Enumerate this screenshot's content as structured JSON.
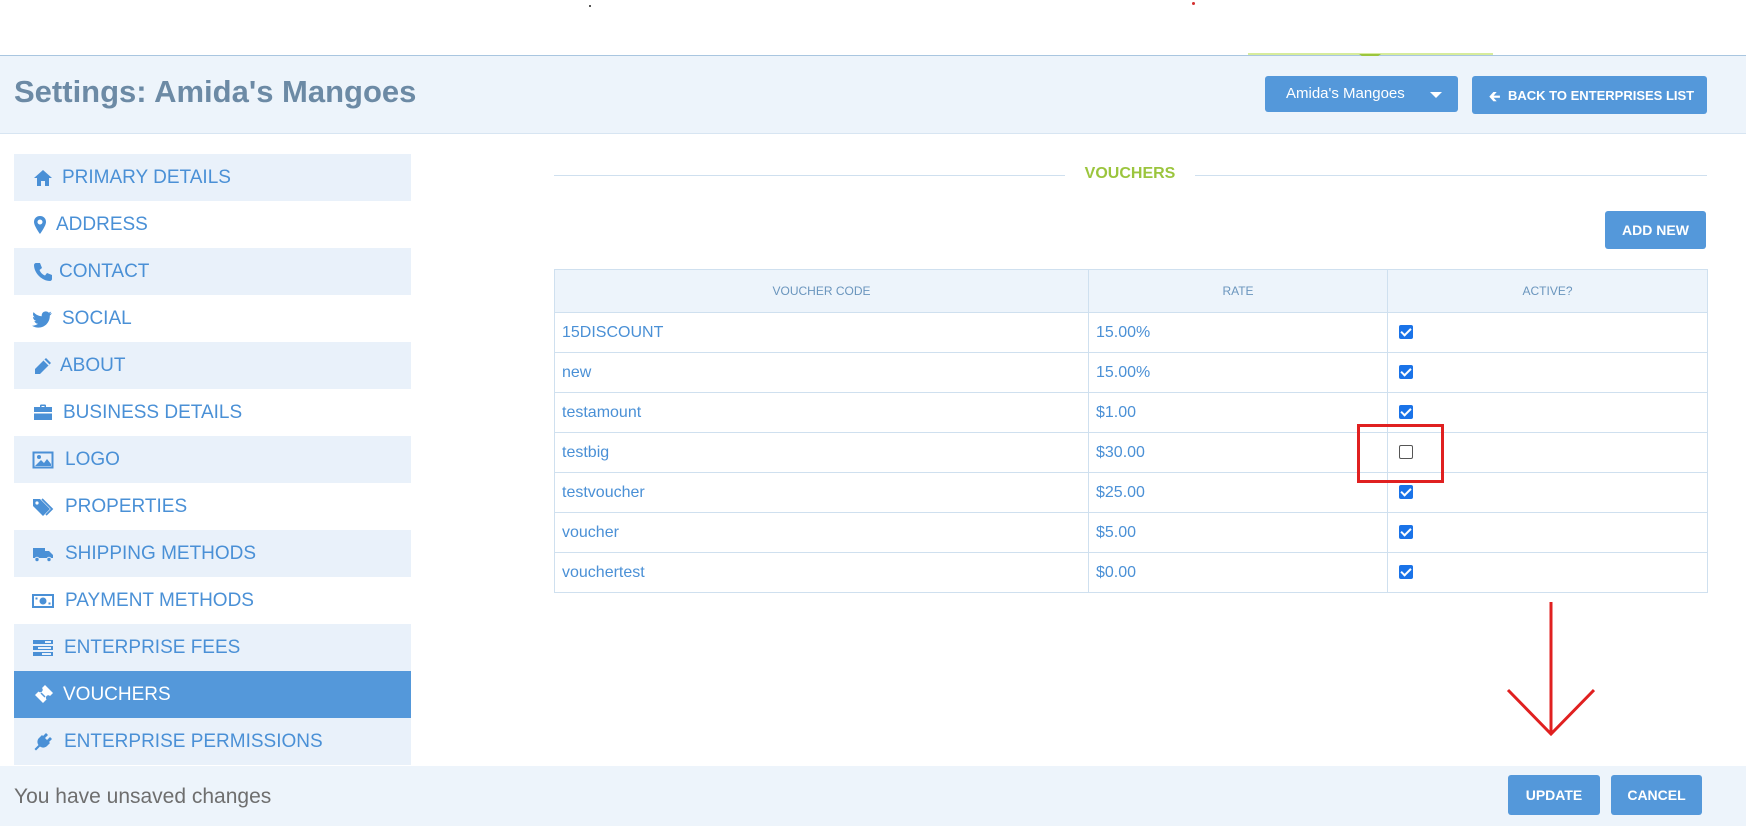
{
  "header": {
    "title": "Settings: Amida's Mangoes",
    "enterprise_select": "Amida's Mangoes",
    "back_button": "BACK TO ENTERPRISES LIST"
  },
  "sidebar": {
    "items": [
      {
        "label": "PRIMARY DETAILS",
        "icon": "home-icon"
      },
      {
        "label": "ADDRESS",
        "icon": "map-marker-icon"
      },
      {
        "label": "CONTACT",
        "icon": "phone-icon"
      },
      {
        "label": "SOCIAL",
        "icon": "twitter-icon"
      },
      {
        "label": "ABOUT",
        "icon": "pencil-icon"
      },
      {
        "label": "BUSINESS DETAILS",
        "icon": "briefcase-icon"
      },
      {
        "label": "LOGO",
        "icon": "image-icon"
      },
      {
        "label": "PROPERTIES",
        "icon": "tags-icon"
      },
      {
        "label": "SHIPPING METHODS",
        "icon": "truck-icon"
      },
      {
        "label": "PAYMENT METHODS",
        "icon": "money-icon"
      },
      {
        "label": "ENTERPRISE FEES",
        "icon": "tasks-icon"
      },
      {
        "label": "VOUCHERS",
        "icon": "ticket-icon",
        "active": true
      },
      {
        "label": "ENTERPRISE PERMISSIONS",
        "icon": "plug-icon"
      }
    ]
  },
  "vouchers": {
    "section_title": "VOUCHERS",
    "add_button": "ADD NEW",
    "columns": [
      "VOUCHER CODE",
      "RATE",
      "ACTIVE?"
    ],
    "rows": [
      {
        "code": "15DISCOUNT",
        "rate": "15.00%",
        "active": true
      },
      {
        "code": "new",
        "rate": "15.00%",
        "active": true
      },
      {
        "code": "testamount",
        "rate": "$1.00",
        "active": true
      },
      {
        "code": "testbig",
        "rate": "$30.00",
        "active": false
      },
      {
        "code": "testvoucher",
        "rate": "$25.00",
        "active": true
      },
      {
        "code": "voucher",
        "rate": "$5.00",
        "active": true
      },
      {
        "code": "vouchertest",
        "rate": "$0.00",
        "active": true
      }
    ]
  },
  "footer": {
    "unsaved_text": "You have unsaved changes",
    "update_button": "UPDATE",
    "cancel_button": "CANCEL"
  },
  "colors": {
    "accent": "#5498da",
    "section_title": "#9bc53d",
    "annotation": "#e02020"
  }
}
